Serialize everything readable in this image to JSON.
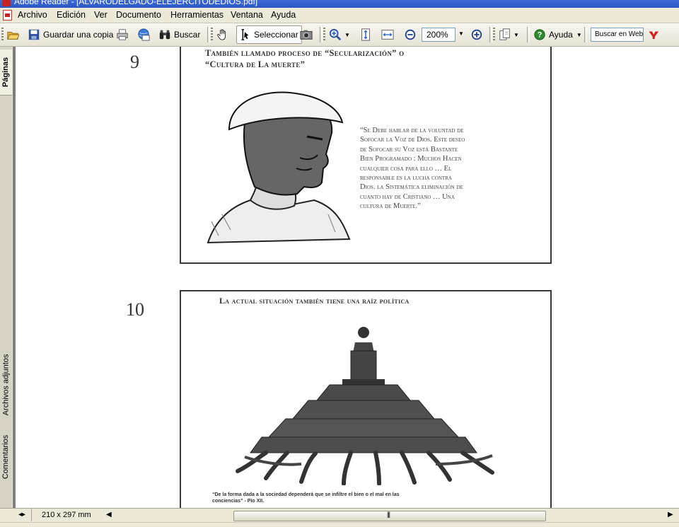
{
  "window": {
    "title": "Adobe Reader - [ALVARODELGADO-ELEJERCITODEDIOS.pdf]"
  },
  "menu": [
    "Archivo",
    "Edición",
    "Ver",
    "Documento",
    "Herramientas",
    "Ventana",
    "Ayuda"
  ],
  "toolbar": {
    "save_copy_label": "Guardar una copia",
    "search_label": "Buscar",
    "select_label": "Seleccionar",
    "zoom_value": "200%",
    "help_label": "Ayuda",
    "web_search_placeholder": "Buscar en Web"
  },
  "sidebar": {
    "tabs": [
      "Páginas",
      "Archivos adjuntos",
      "Comentarios"
    ]
  },
  "document": {
    "panel9": {
      "number": "9",
      "heading_line1": "También llamado proceso de  “Secularización”  o",
      "heading_line2": "“Cultura de La muerte”",
      "quote_lines": [
        "“Se Debe hablar de la voluntad de",
        "Sofocar la Voz de Dios. Este deseo",
        "de Sofocar su Voz está Bastante",
        "Bien Programado : Muchos Hacen",
        "cualquier  cosa para ello …  El",
        "responsable es la lucha contra",
        "Dios. la Sistemática eliminación de",
        "cuanto hay de  Cristiano … Una",
        "cultura de Muerte.”"
      ]
    },
    "panel10": {
      "number": "10",
      "heading": "La actual situación también tiene una raíz política",
      "caption_line1": "“De la forma dada a la sociedad dependerá que se infiltre el bien o el mal en las",
      "caption_line2": "conciencias” - Pío XII."
    }
  },
  "statusbar": {
    "page_size": "210 x 297 mm"
  }
}
